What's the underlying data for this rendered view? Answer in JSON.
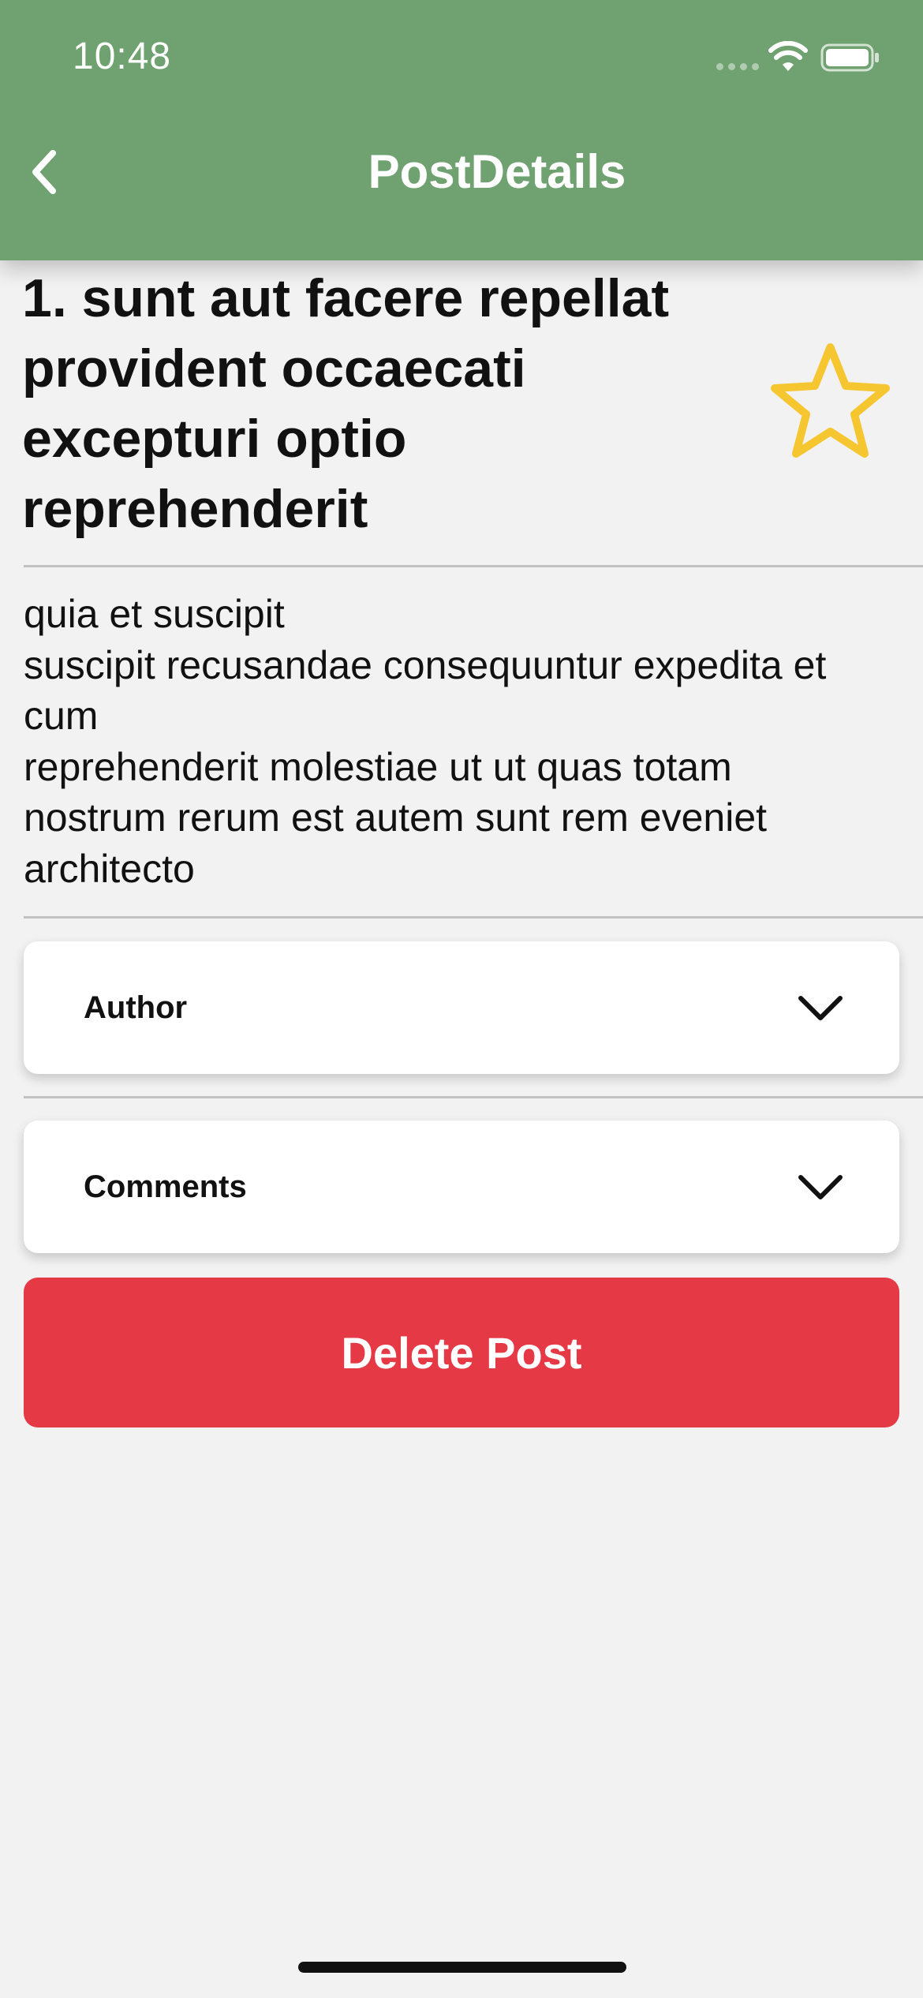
{
  "status_bar": {
    "time": "10:48"
  },
  "header": {
    "title": "PostDetails",
    "back_icon": "chevron-left-icon",
    "background_color": "#6fa270"
  },
  "post": {
    "title": "1. sunt aut facere repellat provident occaecati excepturi optio reprehenderit",
    "body": "quia et suscipit\nsuscipit recusandae consequuntur expedita et cum\nreprehenderit molestiae ut ut quas totam\nnostrum rerum est autem sunt rem eveniet architecto",
    "favorite_icon": "star-outline-icon",
    "favorite_color": "#f6c631"
  },
  "sections": {
    "author_label": "Author",
    "comments_label": "Comments",
    "toggle_icon": "chevron-down-icon"
  },
  "actions": {
    "delete_label": "Delete Post",
    "delete_color": "#e63946"
  }
}
